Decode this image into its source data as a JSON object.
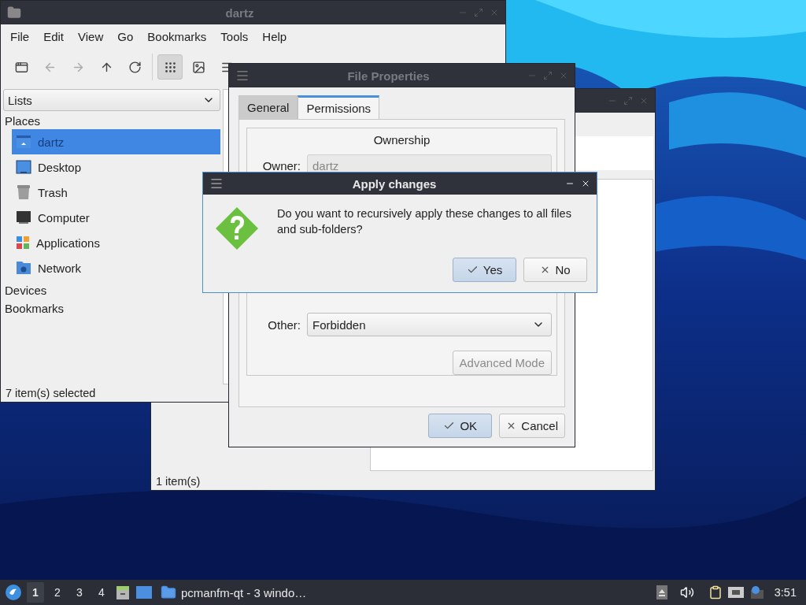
{
  "file_manager": {
    "title": "dartz",
    "menu": [
      "File",
      "Edit",
      "View",
      "Go",
      "Bookmarks",
      "Tools",
      "Help"
    ],
    "navigation": [
      {
        "kind": "new-window",
        "disabled": false
      },
      {
        "kind": "back",
        "disabled": true
      },
      {
        "kind": "forward",
        "disabled": true
      },
      {
        "kind": "up",
        "disabled": false
      },
      {
        "kind": "reload",
        "disabled": false
      }
    ],
    "view_modes": [
      {
        "kind": "icon-view",
        "selected": true
      },
      {
        "kind": "thumbnail-view",
        "selected": false
      },
      {
        "kind": "list-view",
        "selected": false
      }
    ],
    "side_pane_mode": "Lists",
    "sections": [
      {
        "label": "Places",
        "items": [
          {
            "label": "dartz",
            "kind": "home",
            "selected": true
          },
          {
            "label": "Desktop",
            "kind": "desktop",
            "selected": false
          },
          {
            "label": "Trash",
            "kind": "trash",
            "selected": false
          },
          {
            "label": "Computer",
            "kind": "computer",
            "selected": false
          },
          {
            "label": "Applications",
            "kind": "applications",
            "selected": false
          },
          {
            "label": "Network",
            "kind": "network",
            "selected": false
          }
        ]
      },
      {
        "label": "Devices"
      },
      {
        "label": "Bookmarks"
      }
    ],
    "status": "7 item(s) selected"
  },
  "second_window": {
    "status": "1 item(s)"
  },
  "properties": {
    "title": "File Properties",
    "tabs": [
      {
        "label": "General",
        "selected": false
      },
      {
        "label": "Permissions",
        "selected": true
      }
    ],
    "group_title": "Ownership",
    "owner": {
      "label": "Owner:",
      "value": "dartz"
    },
    "other": {
      "label": "Other:",
      "value": "Forbidden"
    },
    "advanced": {
      "label": "Advanced Mode",
      "disabled": true
    },
    "buttons": [
      {
        "label": "OK",
        "kind": "ok",
        "default": true
      },
      {
        "label": "Cancel",
        "kind": "cancel",
        "default": false
      }
    ]
  },
  "dialog": {
    "title": "Apply changes",
    "message": "Do you want to recursively apply these changes to all files and sub-folders?",
    "buttons": [
      {
        "label": "Yes",
        "kind": "ok",
        "default": true
      },
      {
        "label": "No",
        "kind": "cancel",
        "default": false
      }
    ]
  },
  "taskbar": {
    "workspaces": [
      {
        "label": "1",
        "selected": true
      },
      {
        "label": "2",
        "selected": false
      },
      {
        "label": "3",
        "selected": false
      },
      {
        "label": "4",
        "selected": false
      }
    ],
    "task": "pcmanfm-qt - 3 windo…",
    "clock": "3:51"
  }
}
